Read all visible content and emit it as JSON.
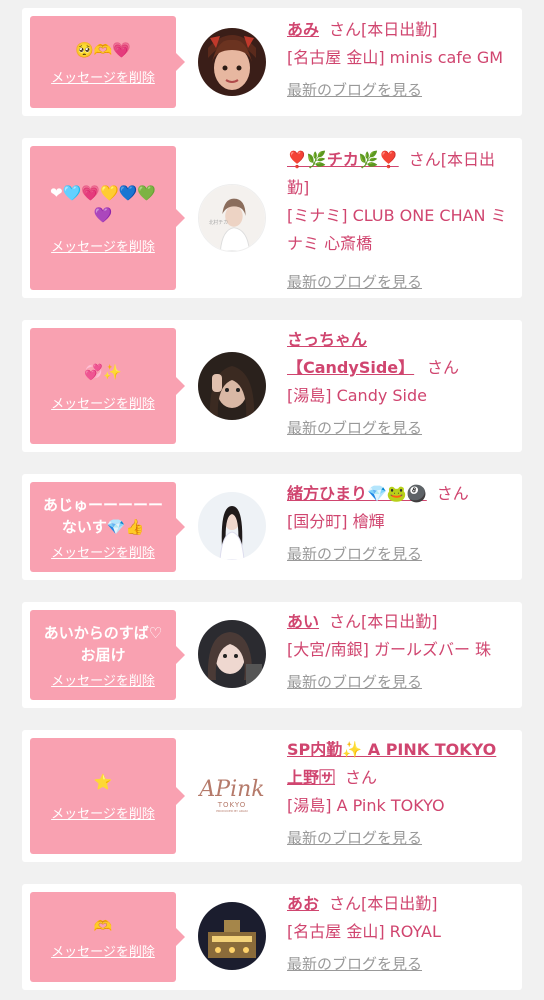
{
  "delete_label": "メッセージを削除",
  "blog_label": "最新のブログを見る",
  "san_label": "さん",
  "colors": {
    "accent": "#d0456f",
    "bubble": "#f9a1b1",
    "blog_link": "#999999"
  },
  "items": [
    {
      "bubble_text": "🥺🫶💗",
      "name": "あみ",
      "after_name": "[本日出勤]",
      "lines": [
        "[名古屋 金山] minis cafe GM"
      ]
    },
    {
      "bubble_text": "❤🩵💗💛💙💚💜",
      "name": "❣️🌿チカ🌿❣️",
      "after_name": "[本日出勤]",
      "lines": [
        "[ミナミ] CLUB ONE CHAN ミナミ 心斎橋"
      ]
    },
    {
      "bubble_text": "💞✨",
      "name": "さっちゃん【CandySide】",
      "after_name": "",
      "lines": [
        "[湯島] Candy Side"
      ]
    },
    {
      "bubble_text": "あじゅーーーーーないす💎👍",
      "name": "緒方ひまり💎🐸🎱",
      "after_name": "",
      "lines": [
        "[国分町] 檜輝"
      ]
    },
    {
      "bubble_text": "あいからのすば♡お届け",
      "name": "あい",
      "after_name": "[本日出勤]",
      "lines": [
        "[大宮/南銀] ガールズバー 珠"
      ]
    },
    {
      "bubble_text": "⭐",
      "name": "SP内勤✨ A PINK TOKYO 上野🈂",
      "after_name": "",
      "lines": [
        "[湯島] A Pink TOKYO"
      ]
    },
    {
      "bubble_text": "🫶",
      "name": "あお",
      "after_name": "[本日出勤]",
      "lines": [
        "[名古屋 金山] ROYAL"
      ]
    }
  ],
  "logo": {
    "brand": "APink",
    "sub": "TOKYO",
    "tag": "PRODUCED BY ARAKI"
  }
}
